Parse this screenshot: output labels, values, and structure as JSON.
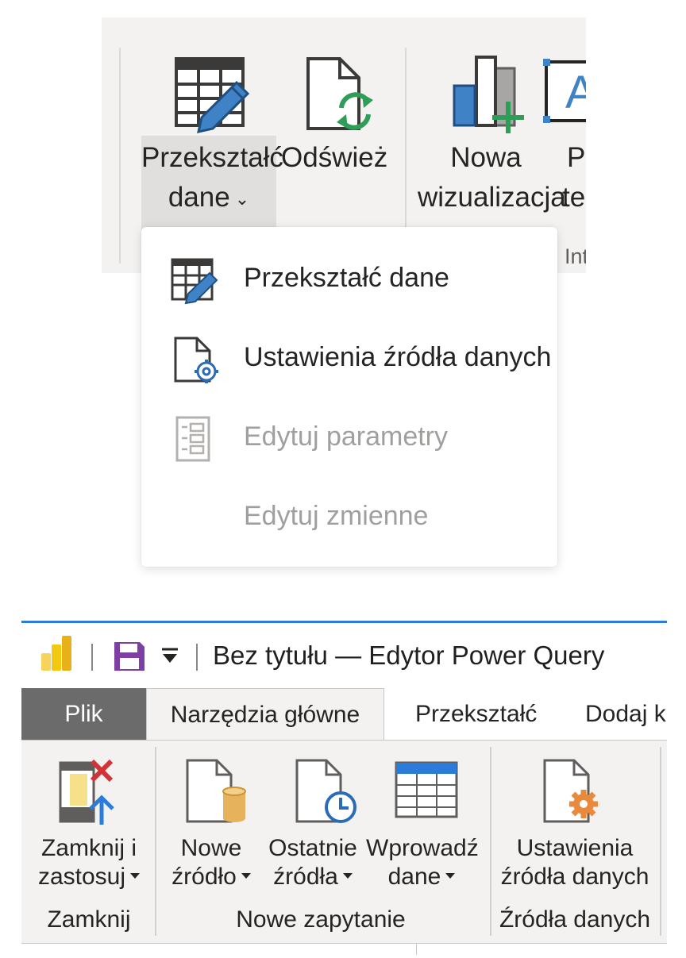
{
  "top_ribbon": {
    "buttons": {
      "transform_line1": "Przekształć",
      "transform_line2": "dane",
      "refresh": "Odśwież",
      "new_visual_line1": "Nowa",
      "new_visual_line2": "wizualizacja",
      "text_box_partial_line1": "P",
      "text_box_partial_line2": "te"
    },
    "group_partial": "Int"
  },
  "transform_menu": {
    "items": [
      {
        "label": "Przekształć dane",
        "icon": "table-edit-icon",
        "enabled": true
      },
      {
        "label": "Ustawienia źródła danych",
        "icon": "document-gear-icon",
        "enabled": true
      },
      {
        "label": "Edytuj parametry",
        "icon": "parameters-icon",
        "enabled": false
      },
      {
        "label": "Edytuj zmienne",
        "icon": "",
        "enabled": false
      }
    ]
  },
  "power_query": {
    "title": "Bez tytułu — Edytor Power Query",
    "accent_color": "#2b7bd8",
    "tabs": [
      "Plik",
      "Narzędzia główne",
      "Przekształć",
      "Dodaj ko"
    ],
    "active_tab": "Narzędzia główne",
    "buttons": {
      "close_apply_line1": "Zamknij i",
      "close_apply_line2": "zastosuj",
      "new_source_line1": "Nowe",
      "new_source_line2": "źródło",
      "recent_sources_line1": "Ostatnie",
      "recent_sources_line2": "źródła",
      "enter_data_line1": "Wprowadź",
      "enter_data_line2": "dane",
      "source_settings_line1": "Ustawienia",
      "source_settings_line2": "źródła danych"
    },
    "groups": {
      "close": "Zamknij",
      "new_query": "Nowe zapytanie",
      "data_sources": "Źródła danych"
    }
  }
}
